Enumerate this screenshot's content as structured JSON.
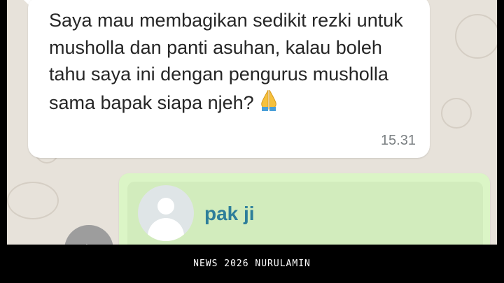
{
  "incoming_message": {
    "text": "Saya mau membagikan sedikit rezki untuk musholla dan panti asuhan, kalau boleh tahu saya ini dengan pengurus musholla sama bapak siapa njeh?",
    "emoji": "folded-hands",
    "time": "15.31"
  },
  "outgoing_message": {
    "contact_name": "pak ji"
  },
  "footer": {
    "caption": "NEWS 2026 NURULAMIN"
  },
  "colors": {
    "chat_background": "#e7e2da",
    "incoming_bubble": "#ffffff",
    "outgoing_bubble": "#dbf5c6",
    "contact_name": "#2d7e9a",
    "timestamp": "#7b8083"
  }
}
